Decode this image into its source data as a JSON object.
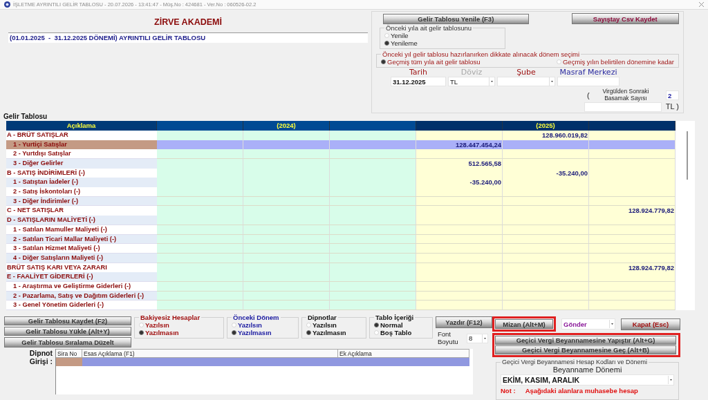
{
  "title_bar": {
    "title": "İŞLETME AYRINTILI GELİR TABLOSU - 20.07.2026 - 13:41:47 - Müş.No : 424681 - Ver.No : 060526-02.2"
  },
  "company": "ZİRVE AKADEMİ",
  "period_field": {
    "value": "(01.01.2025  -  31.12.2025 DÖNEMİ) AYRINTILI GELİR TABLOSU"
  },
  "settings_panel": {
    "refresh_button": "Gelir Tablosu Yenile (F3)",
    "csv_button": "Sayıştay Csv Kaydet",
    "previous_year_group": {
      "title": "Önceki yıla ait gelir tablosunu",
      "options": [
        {
          "label": "Yenile",
          "selected": false
        },
        {
          "label": "Yenileme",
          "selected": true
        }
      ]
    },
    "period_choice_group": {
      "title": "Önceki yıl gelir tablosu hazırlanırken dikkate alınacak dönem seçimi",
      "options": [
        {
          "label": "Geçmiş tüm yıla ait gelir tablosu",
          "selected": true
        },
        {
          "label": "Geçmiş yılın belirtilen dönemine kadar",
          "selected": false
        }
      ]
    },
    "fields": [
      {
        "label": "Tarih",
        "value": "31.12.2025",
        "kind": "text",
        "color": "#a01818"
      },
      {
        "label": "Döviz",
        "value": "TL",
        "kind": "select",
        "color": "#a8a8a8"
      },
      {
        "label": "Şube",
        "kind": "select",
        "color": "#a01818"
      },
      {
        "label": "Masraf Merkezi",
        "kind": "text",
        "color": "#2a2aa0"
      }
    ],
    "decimal_open": "(",
    "decimal_label": "Virgülden Sonraki Basamak Sayısı",
    "decimal_value": "2",
    "currency_close": "TL )"
  },
  "table": {
    "title": "Gelir Tablosu",
    "header": "Açıklama",
    "year_headers": [
      "(2024)",
      "(2025)"
    ],
    "rows": [
      {
        "label": "A - BRÜT SATIŞLAR",
        "kind": "group",
        "selected": false,
        "column_6": "128.960.019,82"
      },
      {
        "label": "1 - Yurtiçi Satışlar",
        "kind": "item",
        "selected": true,
        "column_5": "128.447.454,24"
      },
      {
        "label": "2 - Yurtdışı Satışlar",
        "kind": "item",
        "selected": false
      },
      {
        "label": "3 - Diğer Gelirler",
        "kind": "item",
        "selected": false,
        "column_5": "512.565,58"
      },
      {
        "label": "B - SATIŞ İNDİRİMLERİ (-)",
        "kind": "group",
        "selected": false,
        "column_6": "-35.240,00"
      },
      {
        "label": "1 - Satıştan İadeler (-)",
        "kind": "item",
        "selected": false,
        "column_5": "-35.240,00"
      },
      {
        "label": "2 - Satış İskontoları (-)",
        "kind": "item",
        "selected": false
      },
      {
        "label": "3 - Diğer İndirimler (-)",
        "kind": "item",
        "selected": false
      },
      {
        "label": "C - NET SATIŞLAR",
        "kind": "group",
        "selected": false,
        "column_7": "128.924.779,82"
      },
      {
        "label": "D - SATIŞLARIN MALİYETİ (-)",
        "kind": "group",
        "selected": false
      },
      {
        "label": "1 - Satılan Mamuller Maliyeti (-)",
        "kind": "item",
        "selected": false
      },
      {
        "label": "2 - Satılan Ticari Mallar Maliyeti (-)",
        "kind": "item",
        "selected": false
      },
      {
        "label": "3 - Satılan Hizmet Maliyeti (-)",
        "kind": "item",
        "selected": false
      },
      {
        "label": "4 - Diğer Satışların Maliyeti (-)",
        "kind": "item",
        "selected": false
      },
      {
        "label": "BRÜT SATIŞ KARI VEYA ZARARI",
        "kind": "group",
        "selected": false,
        "column_7": "128.924.779,82"
      },
      {
        "label": "E - FAALİYET GİDERLERİ (-)",
        "kind": "group",
        "selected": false
      },
      {
        "label": "1 - Araştırma ve Geliştirme Giderleri (-)",
        "kind": "item",
        "selected": false
      },
      {
        "label": "2 - Pazarlama, Satış ve Dağıtım Giderleri (-)",
        "kind": "item",
        "selected": false
      },
      {
        "label": "3 - Genel Yönetim Giderleri (-)",
        "kind": "item",
        "selected": false
      }
    ]
  },
  "bottom": {
    "save_button": "Gelir Tablosu Kaydet (F2)",
    "load_button": "Gelir Tablosu Yükle (Alt+Y)",
    "sort_button": "Gelir Tablosu Sıralama Düzelt",
    "option_groups": [
      {
        "title": "Bakiyesiz Hesaplar",
        "color": "#a01010",
        "options": [
          {
            "label": "Yazılsın",
            "selected": false
          },
          {
            "label": "Yazılmasın",
            "selected": true
          }
        ]
      },
      {
        "title": "Önceki Dönem",
        "color": "#1a1aa0",
        "options": [
          {
            "label": "Yazılsın",
            "selected": false
          },
          {
            "label": "Yazılmasın",
            "selected": true
          }
        ]
      },
      {
        "title": "Dipnotlar",
        "color": "#111111",
        "options": [
          {
            "label": "Yazılsın",
            "selected": false
          },
          {
            "label": "Yazılmasın",
            "selected": true
          }
        ]
      },
      {
        "title": "Tablo İçeriği",
        "color": "#111111",
        "options": [
          {
            "label": "Normal",
            "selected": true
          },
          {
            "label": "Boş Tablo",
            "selected": false
          }
        ]
      }
    ],
    "print_button": "Yazdır (F12)",
    "font_size": {
      "label": "Font Boyutu",
      "value": "8"
    },
    "trial_balance_button": "Mizan (Alt+M)",
    "send_select": "Gönder",
    "close_button": "Kapat (Esc)",
    "paste_button": "Geçici Vergi Beyannamesine Yapıştır  (Alt+G)",
    "go_button": "Geçici Vergi Beyannamesine Geç (Alt+B)",
    "footnote": {
      "label": "Dipnot Girişi :",
      "columns": [
        "Sira No",
        "Esas Açıklama (F1)",
        "Ek Açıklama"
      ]
    },
    "declaration": {
      "title": "Geçici Vergi Beyannamesi Hesap Kodları ve Dönemi",
      "period_label": "Beyanname Dönemi",
      "period_value": "EKİM, KASIM, ARALIK",
      "note_label": "Not :",
      "note_text": "Aşağıdaki alanlara muhasebe hesap"
    }
  }
}
